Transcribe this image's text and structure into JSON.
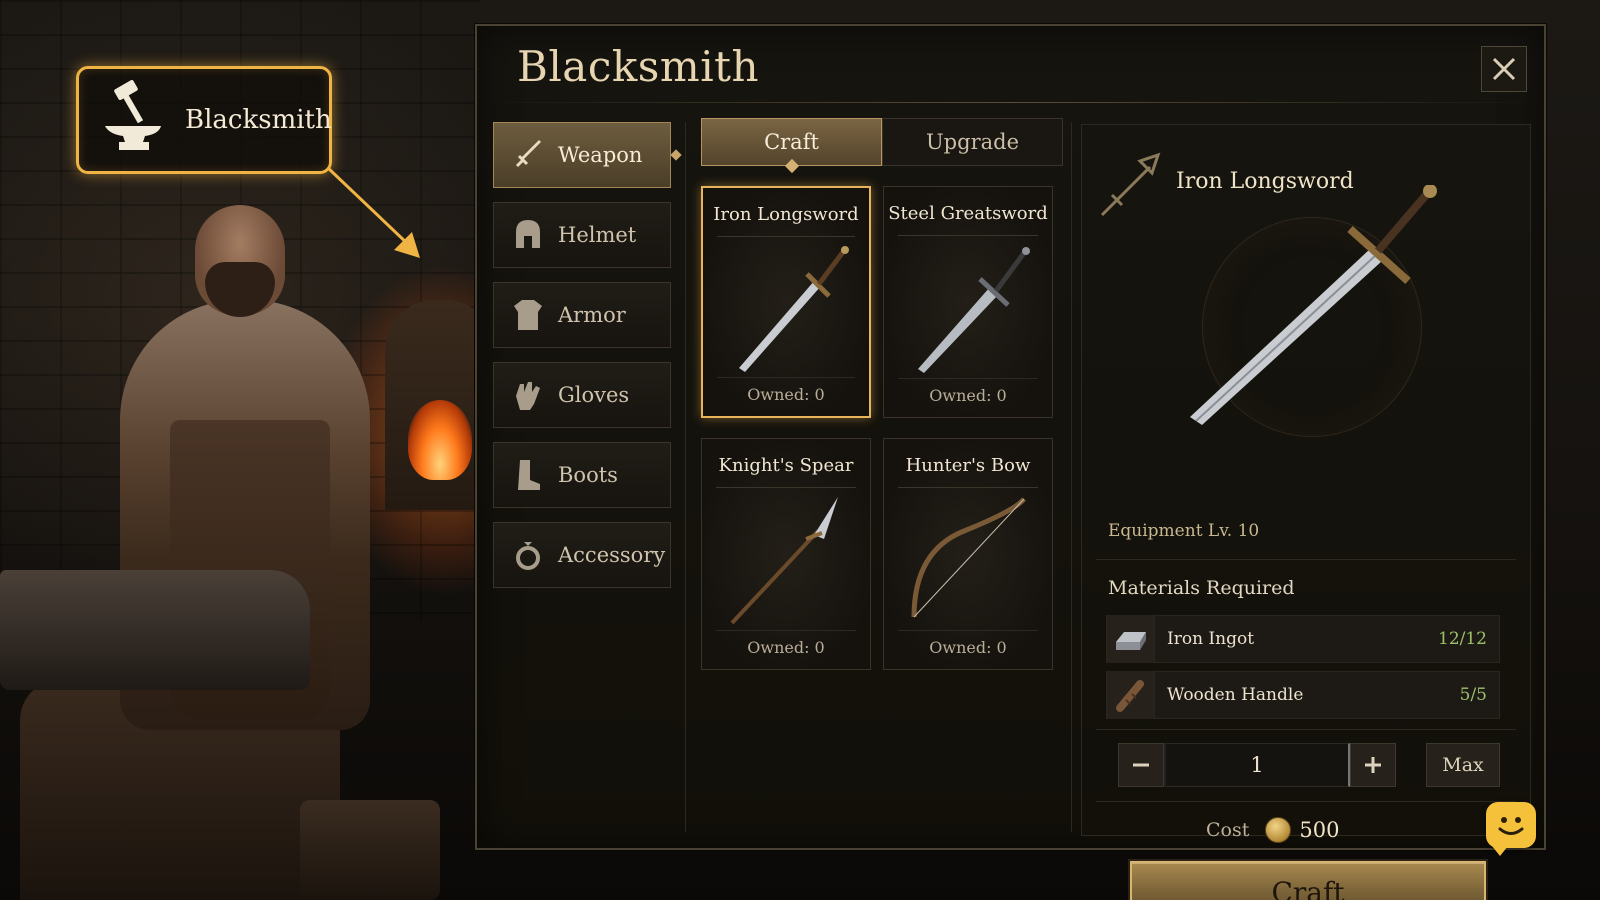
{
  "callout": {
    "label": "Blacksmith",
    "icon": "hammer-anvil-icon",
    "border_color": "#f0b445"
  },
  "panel": {
    "title": "Blacksmith",
    "close_icon": "close-icon"
  },
  "categories": [
    {
      "label": "Weapon",
      "icon": "sword-icon",
      "active": true
    },
    {
      "label": "Helmet",
      "icon": "helmet-icon",
      "active": false
    },
    {
      "label": "Armor",
      "icon": "armor-icon",
      "active": false
    },
    {
      "label": "Gloves",
      "icon": "gloves-icon",
      "active": false
    },
    {
      "label": "Boots",
      "icon": "boots-icon",
      "active": false
    },
    {
      "label": "Accessory",
      "icon": "ring-icon",
      "active": false
    }
  ],
  "tabs": [
    {
      "label": "Craft",
      "active": true
    },
    {
      "label": "Upgrade",
      "active": false
    }
  ],
  "items": [
    {
      "name": "Iron Longsword",
      "owned": "Owned: 0",
      "selected": true,
      "art": "longsword-icon"
    },
    {
      "name": "Steel Greatsword",
      "owned": "Owned: 0",
      "selected": false,
      "art": "greatsword-icon"
    },
    {
      "name": "Knight's Spear",
      "owned": "Owned: 0",
      "selected": false,
      "art": "spear-icon"
    },
    {
      "name": "Hunter's Bow",
      "owned": "Owned: 0",
      "selected": false,
      "art": "bow-icon"
    }
  ],
  "detail": {
    "name": "Iron Longsword",
    "level": "Equipment Lv. 10",
    "materials_title": "Materials Required",
    "materials": [
      {
        "name": "Iron Ingot",
        "qty": "12/12",
        "icon": "iron-ingot-icon"
      },
      {
        "name": "Wooden Handle",
        "qty": "5/5",
        "icon": "wooden-handle-icon"
      }
    ],
    "quantity": "1",
    "max_label": "Max",
    "cost_label": "Cost",
    "cost_value": "500",
    "craft_label": "Craft"
  },
  "colors": {
    "accent_gold": "#d8b671",
    "highlight": "#e8b35a",
    "sufficient_green": "#9cc06a",
    "chat_yellow": "#f6c13a"
  }
}
